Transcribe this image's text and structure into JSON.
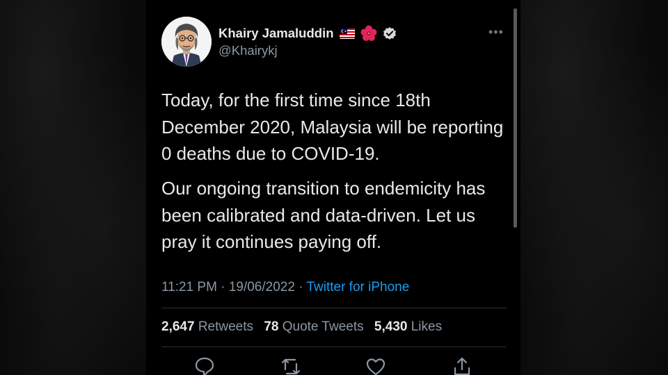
{
  "author": {
    "display_name": "Khairy Jamaluddin",
    "handle": "@Khairykj",
    "badges": [
      "malaysia-flag-icon",
      "hibiscus-icon",
      "verified-icon"
    ]
  },
  "tweet": {
    "paragraph_1": "Today, for the first time since 18th December 2020, Malaysia will be reporting 0 deaths due to COVID-19.",
    "paragraph_2": "Our ongoing transition to endemicity has been calibrated and data-driven. Let us pray it continues paying off.",
    "time": "11:21 PM",
    "separator": "·",
    "date": "19/06/2022",
    "source": "Twitter for iPhone"
  },
  "stats": {
    "retweets_count": "2,647",
    "retweets_label": "Retweets",
    "quote_count": "78",
    "quote_label": "Quote Tweets",
    "likes_count": "5,430",
    "likes_label": "Likes"
  },
  "actions": [
    "reply-icon",
    "retweet-icon",
    "like-icon",
    "share-icon"
  ],
  "colors": {
    "background": "#000000",
    "text": "#e7e9ea",
    "muted": "#8b98a5",
    "link": "#1d9bf0"
  }
}
